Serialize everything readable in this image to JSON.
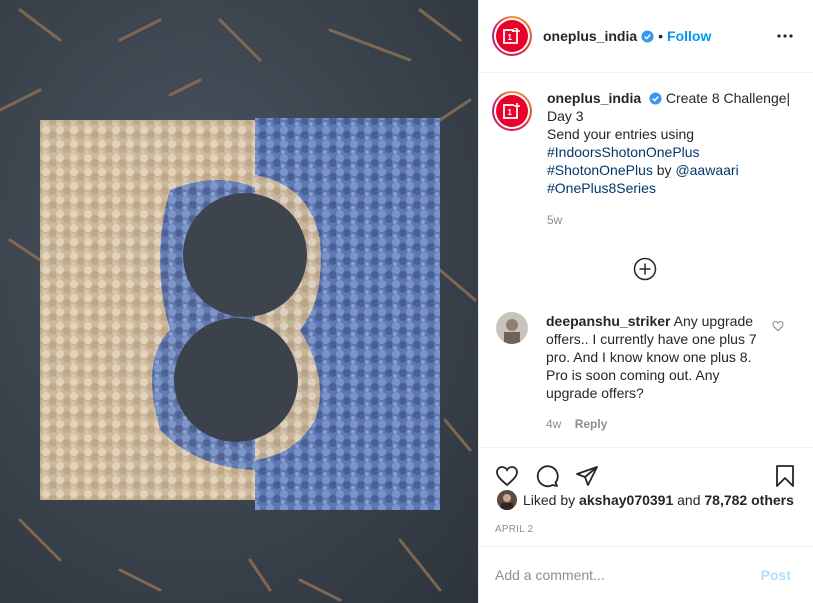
{
  "media": {
    "description_icon": "oneplus-8-flower-art-photo"
  },
  "header": {
    "username": "oneplus_india",
    "dot": "•",
    "follow_label": "Follow"
  },
  "caption": {
    "username": "oneplus_india",
    "lines": [
      "Create 8 Challenge|",
      "Day 3",
      "Send your entries using"
    ],
    "tags": [
      "#IndoorsShotonOnePlus",
      "#ShotonOnePlus",
      "@aawaari",
      "#OnePlus8Series"
    ],
    "by_word": "by",
    "time": "5w"
  },
  "comment": {
    "username": "deepanshu_striker",
    "text": "Any upgrade offers.. I currently have one plus 7 pro. And I know know one plus 8. Pro is soon coming out. Any upgrade offers?",
    "time": "4w",
    "reply_label": "Reply"
  },
  "likes": {
    "prefix": "Liked by",
    "user": "akshay070391",
    "and_word": "and",
    "others": "78,782 others"
  },
  "date": "APRIL 2",
  "add_comment": {
    "placeholder": "Add a comment...",
    "post_label": "Post"
  },
  "colors": {
    "brand_red": "#eb0029",
    "link_blue": "#0095f6",
    "tag_blue": "#00376b",
    "muted": "#8e8e8e"
  }
}
